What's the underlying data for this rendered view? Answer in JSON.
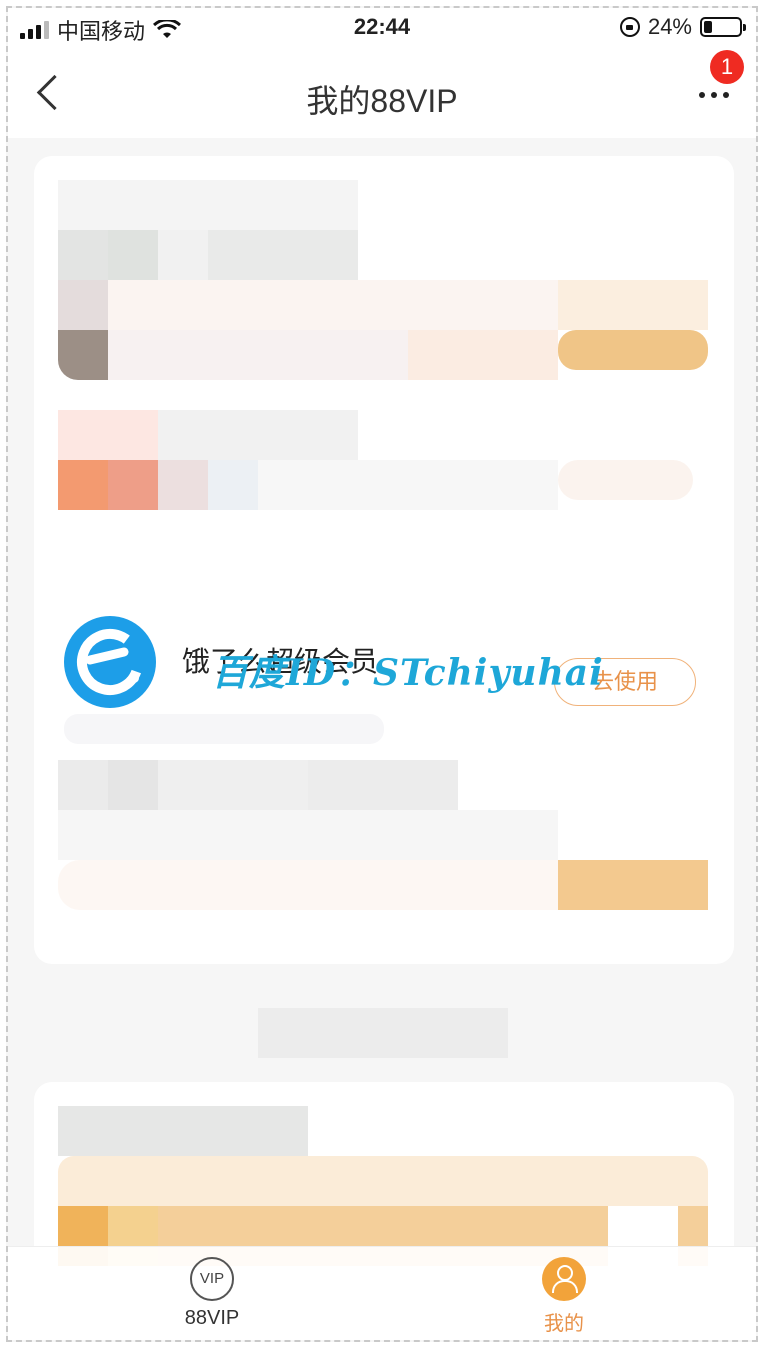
{
  "status_bar": {
    "carrier": "中国移动",
    "time": "22:44",
    "battery_text": "24%",
    "battery_level": 0.24
  },
  "nav": {
    "title": "我的88VIP",
    "badge_count": "1"
  },
  "benefit_item": {
    "title": "饿了么超级会员",
    "action_label": "去使用",
    "icon": "eleme-icon"
  },
  "watermark": {
    "text": "百度ID：STchiyuhai"
  },
  "tab_bar": {
    "tabs": [
      {
        "label": "88VIP",
        "icon_text": "VIP",
        "icon": "vip-icon",
        "active": false
      },
      {
        "label": "我的",
        "icon": "person-icon",
        "active": true
      }
    ]
  },
  "colors": {
    "accent": "#e8924a",
    "badge": "#ef2b22",
    "eleme_blue": "#1d9ee8",
    "watermark": "#1ea7d8"
  }
}
